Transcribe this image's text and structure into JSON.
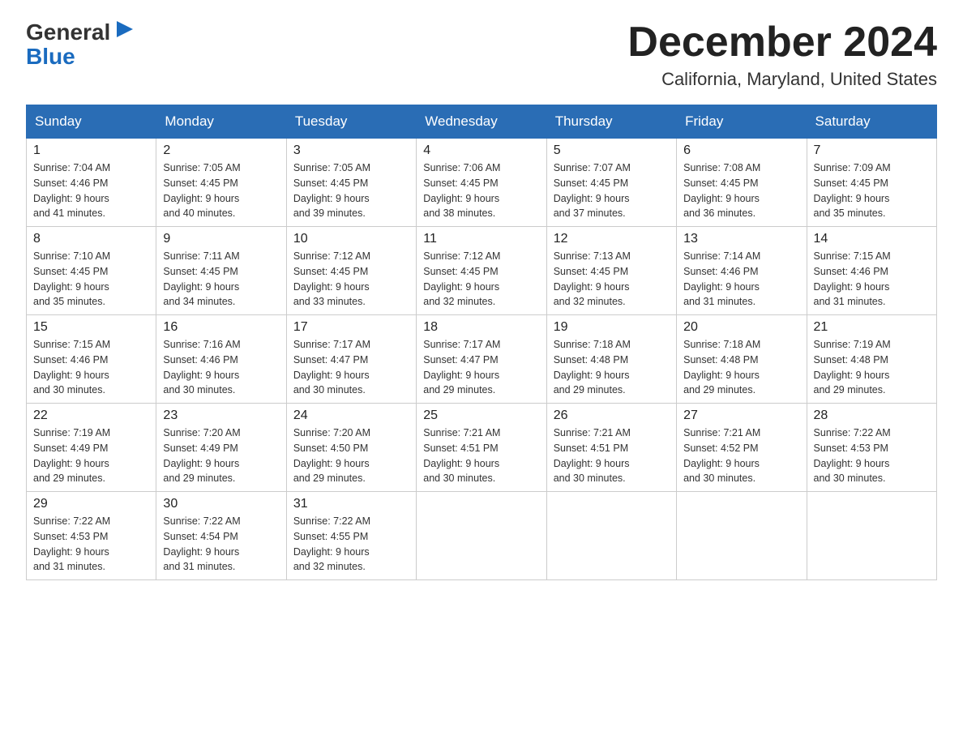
{
  "logo": {
    "general": "General",
    "blue": "Blue"
  },
  "title": "December 2024",
  "subtitle": "California, Maryland, United States",
  "days_of_week": [
    "Sunday",
    "Monday",
    "Tuesday",
    "Wednesday",
    "Thursday",
    "Friday",
    "Saturday"
  ],
  "weeks": [
    [
      {
        "day": "1",
        "sunrise": "7:04 AM",
        "sunset": "4:46 PM",
        "daylight": "9 hours and 41 minutes."
      },
      {
        "day": "2",
        "sunrise": "7:05 AM",
        "sunset": "4:45 PM",
        "daylight": "9 hours and 40 minutes."
      },
      {
        "day": "3",
        "sunrise": "7:05 AM",
        "sunset": "4:45 PM",
        "daylight": "9 hours and 39 minutes."
      },
      {
        "day": "4",
        "sunrise": "7:06 AM",
        "sunset": "4:45 PM",
        "daylight": "9 hours and 38 minutes."
      },
      {
        "day": "5",
        "sunrise": "7:07 AM",
        "sunset": "4:45 PM",
        "daylight": "9 hours and 37 minutes."
      },
      {
        "day": "6",
        "sunrise": "7:08 AM",
        "sunset": "4:45 PM",
        "daylight": "9 hours and 36 minutes."
      },
      {
        "day": "7",
        "sunrise": "7:09 AM",
        "sunset": "4:45 PM",
        "daylight": "9 hours and 35 minutes."
      }
    ],
    [
      {
        "day": "8",
        "sunrise": "7:10 AM",
        "sunset": "4:45 PM",
        "daylight": "9 hours and 35 minutes."
      },
      {
        "day": "9",
        "sunrise": "7:11 AM",
        "sunset": "4:45 PM",
        "daylight": "9 hours and 34 minutes."
      },
      {
        "day": "10",
        "sunrise": "7:12 AM",
        "sunset": "4:45 PM",
        "daylight": "9 hours and 33 minutes."
      },
      {
        "day": "11",
        "sunrise": "7:12 AM",
        "sunset": "4:45 PM",
        "daylight": "9 hours and 32 minutes."
      },
      {
        "day": "12",
        "sunrise": "7:13 AM",
        "sunset": "4:45 PM",
        "daylight": "9 hours and 32 minutes."
      },
      {
        "day": "13",
        "sunrise": "7:14 AM",
        "sunset": "4:46 PM",
        "daylight": "9 hours and 31 minutes."
      },
      {
        "day": "14",
        "sunrise": "7:15 AM",
        "sunset": "4:46 PM",
        "daylight": "9 hours and 31 minutes."
      }
    ],
    [
      {
        "day": "15",
        "sunrise": "7:15 AM",
        "sunset": "4:46 PM",
        "daylight": "9 hours and 30 minutes."
      },
      {
        "day": "16",
        "sunrise": "7:16 AM",
        "sunset": "4:46 PM",
        "daylight": "9 hours and 30 minutes."
      },
      {
        "day": "17",
        "sunrise": "7:17 AM",
        "sunset": "4:47 PM",
        "daylight": "9 hours and 30 minutes."
      },
      {
        "day": "18",
        "sunrise": "7:17 AM",
        "sunset": "4:47 PM",
        "daylight": "9 hours and 29 minutes."
      },
      {
        "day": "19",
        "sunrise": "7:18 AM",
        "sunset": "4:48 PM",
        "daylight": "9 hours and 29 minutes."
      },
      {
        "day": "20",
        "sunrise": "7:18 AM",
        "sunset": "4:48 PM",
        "daylight": "9 hours and 29 minutes."
      },
      {
        "day": "21",
        "sunrise": "7:19 AM",
        "sunset": "4:48 PM",
        "daylight": "9 hours and 29 minutes."
      }
    ],
    [
      {
        "day": "22",
        "sunrise": "7:19 AM",
        "sunset": "4:49 PM",
        "daylight": "9 hours and 29 minutes."
      },
      {
        "day": "23",
        "sunrise": "7:20 AM",
        "sunset": "4:49 PM",
        "daylight": "9 hours and 29 minutes."
      },
      {
        "day": "24",
        "sunrise": "7:20 AM",
        "sunset": "4:50 PM",
        "daylight": "9 hours and 29 minutes."
      },
      {
        "day": "25",
        "sunrise": "7:21 AM",
        "sunset": "4:51 PM",
        "daylight": "9 hours and 30 minutes."
      },
      {
        "day": "26",
        "sunrise": "7:21 AM",
        "sunset": "4:51 PM",
        "daylight": "9 hours and 30 minutes."
      },
      {
        "day": "27",
        "sunrise": "7:21 AM",
        "sunset": "4:52 PM",
        "daylight": "9 hours and 30 minutes."
      },
      {
        "day": "28",
        "sunrise": "7:22 AM",
        "sunset": "4:53 PM",
        "daylight": "9 hours and 30 minutes."
      }
    ],
    [
      {
        "day": "29",
        "sunrise": "7:22 AM",
        "sunset": "4:53 PM",
        "daylight": "9 hours and 31 minutes."
      },
      {
        "day": "30",
        "sunrise": "7:22 AM",
        "sunset": "4:54 PM",
        "daylight": "9 hours and 31 minutes."
      },
      {
        "day": "31",
        "sunrise": "7:22 AM",
        "sunset": "4:55 PM",
        "daylight": "9 hours and 32 minutes."
      },
      null,
      null,
      null,
      null
    ]
  ]
}
